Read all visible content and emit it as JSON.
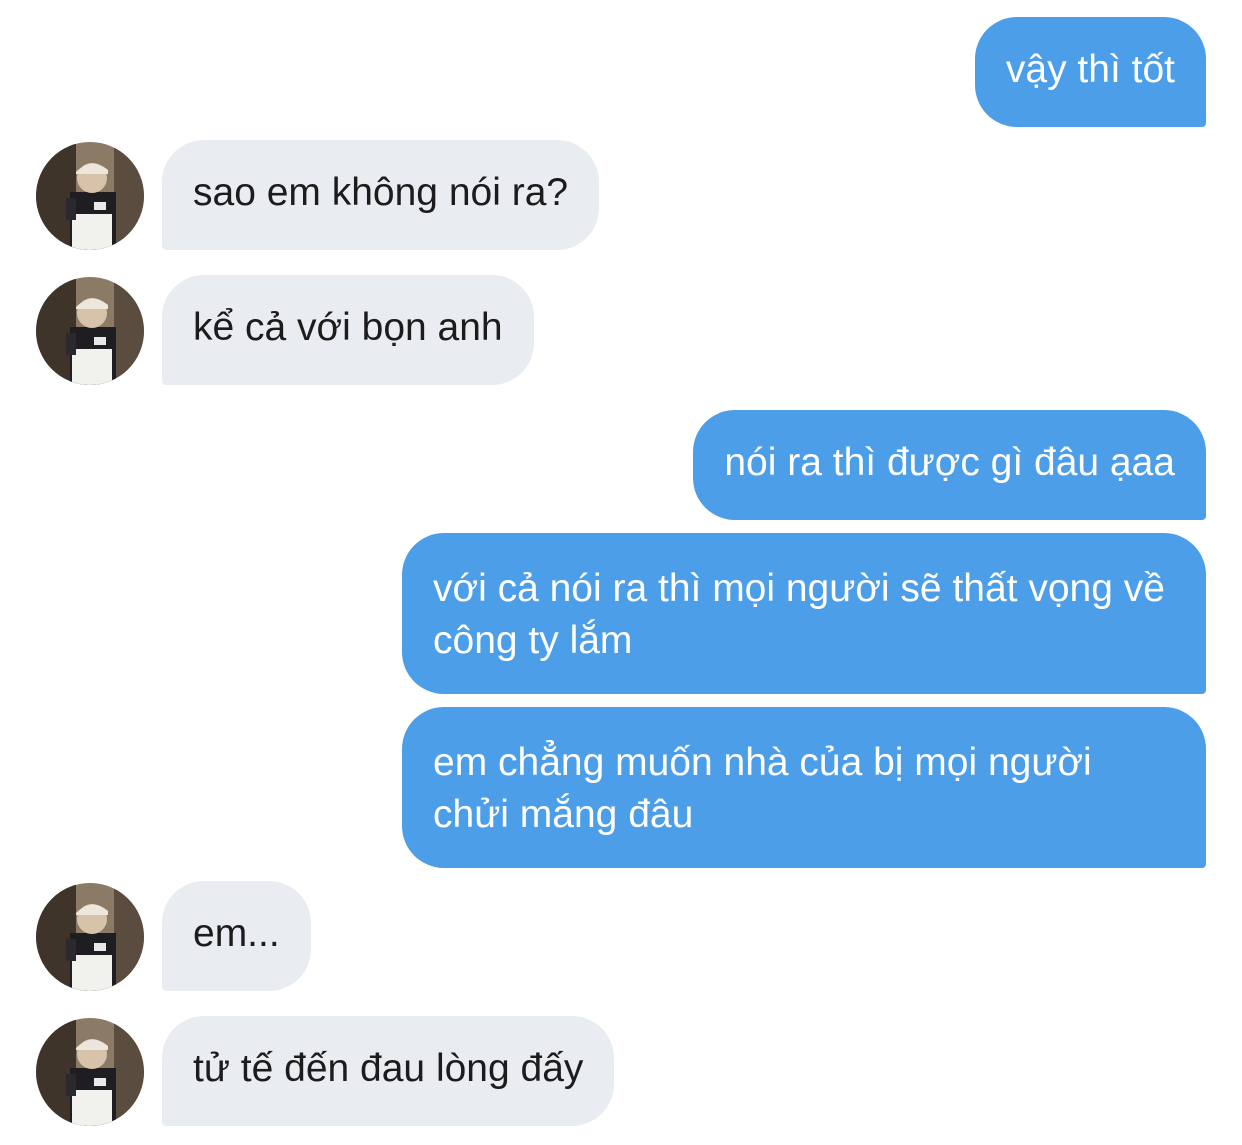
{
  "conversation": {
    "messages": [
      {
        "sender": "me",
        "text": "vậy thì tốt"
      },
      {
        "sender": "contact",
        "text": "sao em không nói ra?"
      },
      {
        "sender": "contact",
        "text": "kể cả với bọn anh"
      },
      {
        "sender": "me",
        "text": "nói ra thì được gì đâu ạaa"
      },
      {
        "sender": "me",
        "text": "với cả nói ra thì mọi người sẽ thất vọng về công ty lắm"
      },
      {
        "sender": "me",
        "text": "em chẳng muốn nhà của bị mọi người chửi mắng đâu"
      },
      {
        "sender": "contact",
        "text": "em..."
      },
      {
        "sender": "contact",
        "text": "tử tế đến đau lòng đấy"
      }
    ]
  },
  "colors": {
    "outgoing_bubble": "#4c9ee8",
    "incoming_bubble": "#e9ecf0",
    "background": "#ffffff"
  },
  "icons": {
    "avatar": "contact-profile-photo"
  }
}
